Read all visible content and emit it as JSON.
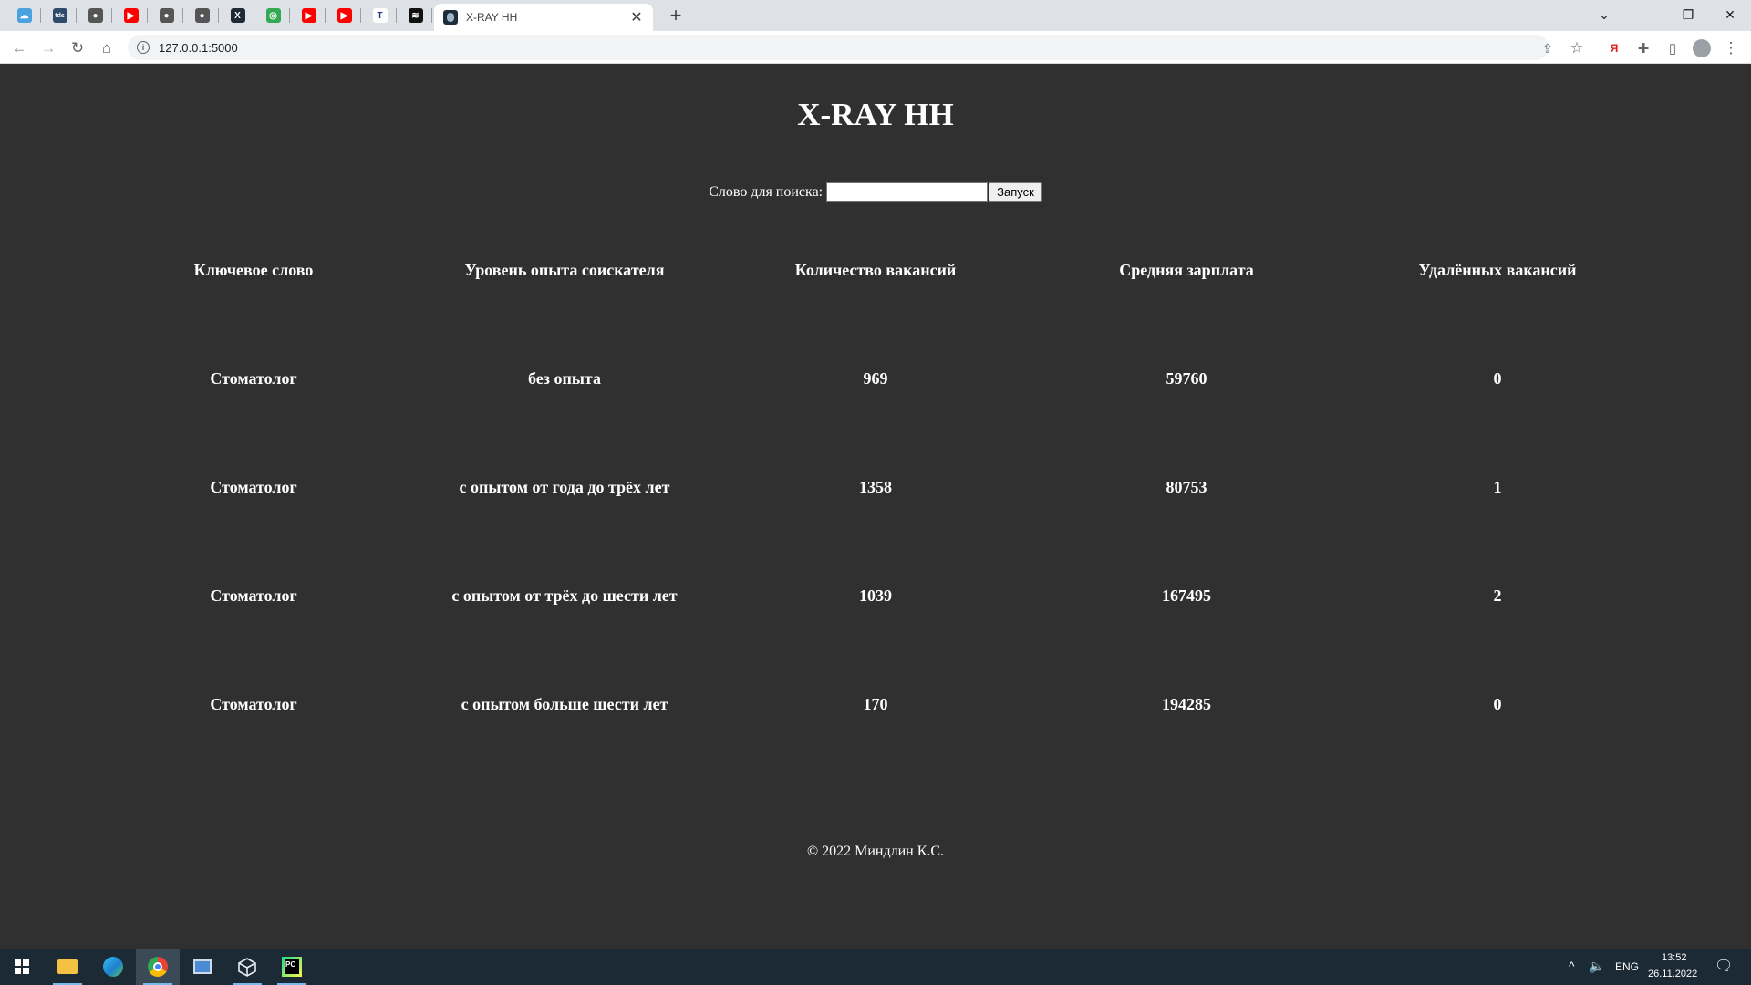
{
  "browser": {
    "pinned_tabs": [
      {
        "icon": "cloud-icon",
        "color": "#4aa3df",
        "glyph": "☁"
      },
      {
        "icon": "tds-icon",
        "color": "#2f4a6b",
        "glyph": "tds"
      },
      {
        "icon": "globe-icon",
        "color": "#555555",
        "glyph": "●"
      },
      {
        "icon": "youtube-icon",
        "color": "#ff0000",
        "glyph": "▶"
      },
      {
        "icon": "globe-icon",
        "color": "#555555",
        "glyph": "●"
      },
      {
        "icon": "globe-icon",
        "color": "#555555",
        "glyph": "●"
      },
      {
        "icon": "x-logo-icon",
        "color": "#1f2a36",
        "glyph": "X"
      },
      {
        "icon": "chrome-like-icon",
        "color": "#35a853",
        "glyph": "◎"
      },
      {
        "icon": "youtube-icon",
        "color": "#ff0000",
        "glyph": "▶"
      },
      {
        "icon": "youtube-icon",
        "color": "#ff0000",
        "glyph": "▶"
      },
      {
        "icon": "t-letter-icon",
        "color": "#ffffff",
        "glyph": "T"
      },
      {
        "icon": "layers-icon",
        "color": "#111111",
        "glyph": "≋"
      }
    ],
    "active_tab_title": "X-RAY HH",
    "url": "127.0.0.1:5000"
  },
  "page": {
    "title": "X-RAY HH",
    "search_label": "Слово для поиска:",
    "search_value": "",
    "search_button": "Запуск",
    "columns": [
      "Ключевое слово",
      "Уровень опыта соискателя",
      "Количество вакансий",
      "Средняя зарплата",
      "Удалённых вакансий"
    ],
    "rows": [
      [
        "Стоматолог",
        "без опыта",
        "969",
        "59760",
        "0"
      ],
      [
        "Стоматолог",
        "с опытом от года до трёх лет",
        "1358",
        "80753",
        "1"
      ],
      [
        "Стоматолог",
        "с опытом от трёх до шести лет",
        "1039",
        "167495",
        "2"
      ],
      [
        "Стоматолог",
        "с опытом больше шести лет",
        "170",
        "194285",
        "0"
      ]
    ],
    "footer": "© 2022 Миндлин К.С."
  },
  "taskbar": {
    "language": "ENG",
    "time": "13:52",
    "date": "26.11.2022"
  },
  "colors": {
    "page_background": "#303030",
    "text": "#ffffff",
    "taskbar": "#1b2a35"
  }
}
